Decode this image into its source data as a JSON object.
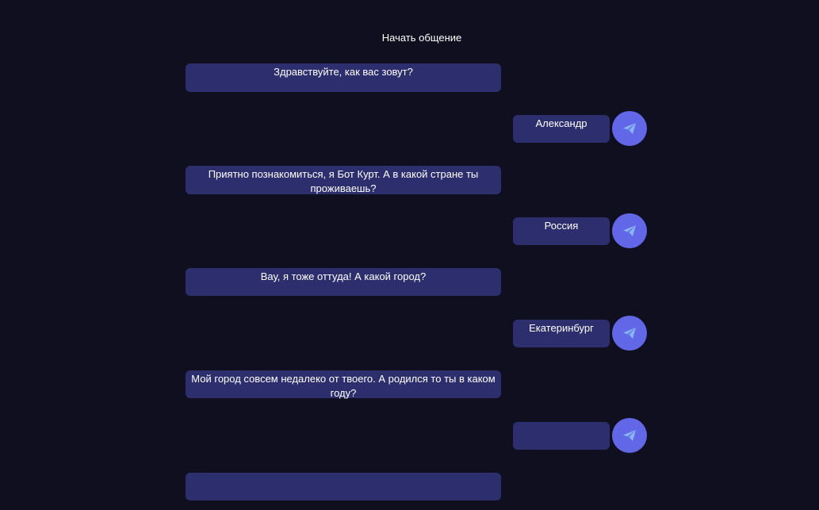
{
  "header": {
    "title": "Начать общение"
  },
  "icons": {
    "send": "send-icon"
  },
  "colors": {
    "background": "#0f0f1f",
    "bubble": "#2d2e6e",
    "send_button": "#6167e6"
  },
  "chat": {
    "bot_messages": [
      "Здравствуйте, как вас зовут?",
      "Приятно познакомиться, я Бот Курт. А в какой стране ты проживаешь?",
      "Вау, я тоже оттуда! А какой город?",
      "Мой город совсем недалеко от твоего. А родился то ты в каком году?",
      ""
    ],
    "user_replies": [
      "Александр",
      "Россия",
      "Екатеринбург",
      ""
    ]
  }
}
